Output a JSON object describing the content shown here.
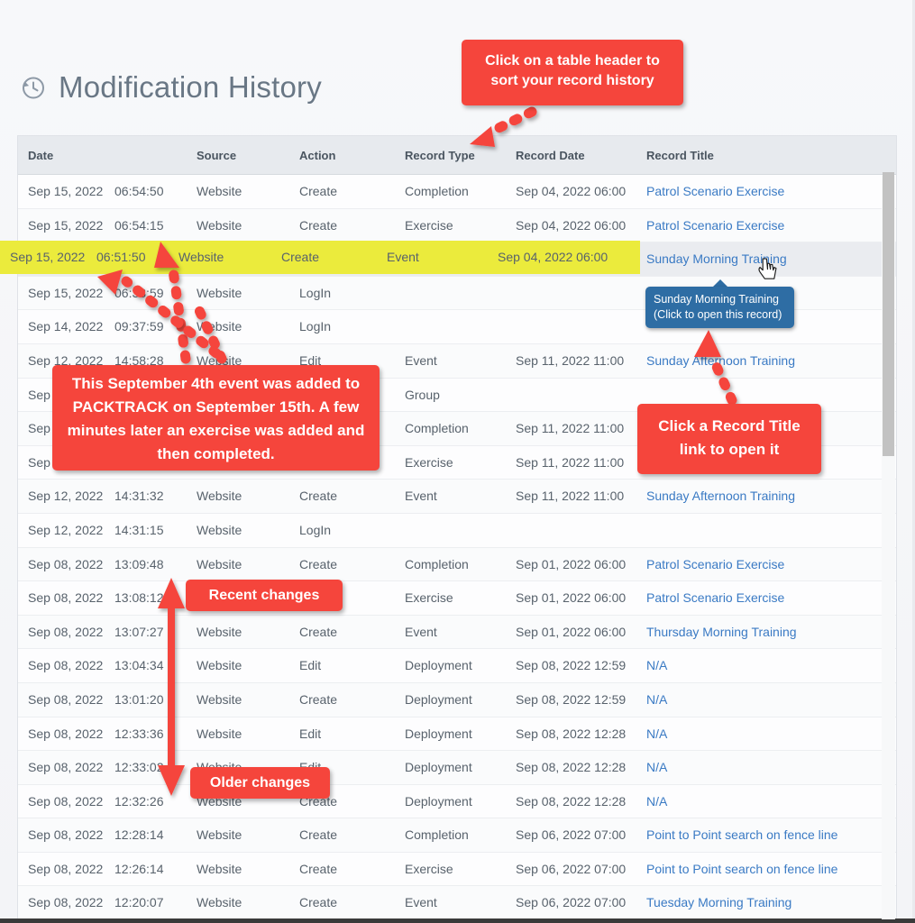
{
  "page": {
    "title": "Modification History",
    "title_icon": "history-clock-icon"
  },
  "table": {
    "columns": [
      "Date",
      "Source",
      "Action",
      "Record Type",
      "Record Date",
      "Record Title"
    ],
    "rows": [
      {
        "date": "Sep 15, 2022",
        "time": "06:54:50",
        "source": "Website",
        "action": "Create",
        "record_type": "Completion",
        "record_date": "Sep 04, 2022 06:00",
        "record_title": "Patrol Scenario Exercise",
        "state": "normal"
      },
      {
        "date": "Sep 15, 2022",
        "time": "06:54:15",
        "source": "Website",
        "action": "Create",
        "record_type": "Exercise",
        "record_date": "Sep 04, 2022 06:00",
        "record_title": "Patrol Scenario Exercise",
        "state": "normal"
      },
      {
        "date": "Sep 15, 2022",
        "time": "06:51:50",
        "source": "Website",
        "action": "Create",
        "record_type": "Event",
        "record_date": "Sep 04, 2022 06:00",
        "record_title": "Sunday Morning Training",
        "state": "highlight"
      },
      {
        "date": "Sep 15, 2022",
        "time": "06:38:59",
        "source": "Website",
        "action": "LogIn",
        "record_type": "",
        "record_date": "",
        "record_title": "",
        "state": "normal"
      },
      {
        "date": "Sep 14, 2022",
        "time": "09:37:59",
        "source": "Website",
        "action": "LogIn",
        "record_type": "",
        "record_date": "",
        "record_title": "",
        "state": "normal"
      },
      {
        "date": "Sep 12, 2022",
        "time": "14:58:28",
        "source": "Website",
        "action": "Edit",
        "record_type": "Event",
        "record_date": "Sep 11, 2022 11:00",
        "record_title": "Sunday Afternoon Training",
        "state": "normal"
      },
      {
        "date": "Sep",
        "time": "",
        "source": "",
        "action": "",
        "record_type": "Group",
        "record_date": "",
        "record_title": "",
        "state": "normal"
      },
      {
        "date": "Sep",
        "time": "",
        "source": "",
        "action": "",
        "record_type": "Completion",
        "record_date": "Sep 11, 2022 11:00",
        "record_title": "",
        "state": "normal"
      },
      {
        "date": "Sep",
        "time": "",
        "source": "",
        "action": "",
        "record_type": "Exercise",
        "record_date": "Sep 11, 2022 11:00",
        "record_title": "",
        "state": "normal"
      },
      {
        "date": "Sep 12, 2022",
        "time": "14:31:32",
        "source": "Website",
        "action": "Create",
        "record_type": "Event",
        "record_date": "Sep 11, 2022 11:00",
        "record_title": "Sunday Afternoon Training",
        "state": "normal"
      },
      {
        "date": "Sep 12, 2022",
        "time": "14:31:15",
        "source": "Website",
        "action": "LogIn",
        "record_type": "",
        "record_date": "",
        "record_title": "",
        "state": "normal"
      },
      {
        "date": "Sep 08, 2022",
        "time": "13:09:48",
        "source": "Website",
        "action": "Create",
        "record_type": "Completion",
        "record_date": "Sep 01, 2022 06:00",
        "record_title": "Patrol Scenario Exercise",
        "state": "normal"
      },
      {
        "date": "Sep 08, 2022",
        "time": "13:08:12",
        "source": "Website",
        "action": "",
        "record_type": "Exercise",
        "record_date": "Sep 01, 2022 06:00",
        "record_title": "Patrol Scenario Exercise",
        "state": "normal"
      },
      {
        "date": "Sep 08, 2022",
        "time": "13:07:27",
        "source": "Website",
        "action": "Create",
        "record_type": "Event",
        "record_date": "Sep 01, 2022 06:00",
        "record_title": "Thursday Morning Training",
        "state": "normal"
      },
      {
        "date": "Sep 08, 2022",
        "time": "13:04:34",
        "source": "Website",
        "action": "Edit",
        "record_type": "Deployment",
        "record_date": "Sep 08, 2022 12:59",
        "record_title": "N/A",
        "state": "normal"
      },
      {
        "date": "Sep 08, 2022",
        "time": "13:01:20",
        "source": "Website",
        "action": "Create",
        "record_type": "Deployment",
        "record_date": "Sep 08, 2022 12:59",
        "record_title": "N/A",
        "state": "normal"
      },
      {
        "date": "Sep 08, 2022",
        "time": "12:33:36",
        "source": "Website",
        "action": "Edit",
        "record_type": "Deployment",
        "record_date": "Sep 08, 2022 12:28",
        "record_title": "N/A",
        "state": "normal"
      },
      {
        "date": "Sep 08, 2022",
        "time": "12:33:02",
        "source": "Website",
        "action": "Edit",
        "record_type": "Deployment",
        "record_date": "Sep 08, 2022 12:28",
        "record_title": "N/A",
        "state": "normal"
      },
      {
        "date": "Sep 08, 2022",
        "time": "12:32:26",
        "source": "Website",
        "action": "Create",
        "record_type": "Deployment",
        "record_date": "Sep 08, 2022 12:28",
        "record_title": "N/A",
        "state": "normal"
      },
      {
        "date": "Sep 08, 2022",
        "time": "12:28:14",
        "source": "Website",
        "action": "Create",
        "record_type": "Completion",
        "record_date": "Sep 06, 2022 07:00",
        "record_title": "Point to Point search on fence line",
        "state": "normal"
      },
      {
        "date": "Sep 08, 2022",
        "time": "12:26:14",
        "source": "Website",
        "action": "Create",
        "record_type": "Exercise",
        "record_date": "Sep 06, 2022 07:00",
        "record_title": "Point to Point search on fence line",
        "state": "normal"
      },
      {
        "date": "Sep 08, 2022",
        "time": "12:20:07",
        "source": "Website",
        "action": "Create",
        "record_type": "Event",
        "record_date": "Sep 06, 2022 07:00",
        "record_title": "Tuesday Morning Training",
        "state": "normal"
      }
    ]
  },
  "annotations": {
    "sort_callout": "Click on a table header to sort your record history",
    "explain_callout": "This September 4th event was added to PACKTRACK on September 15th. A few minutes later an exercise was added and then completed.",
    "open_callout": "Click a Record Title link to open it",
    "recent_badge": "Recent changes",
    "older_badge": "Older changes"
  },
  "tooltip": {
    "line1": "Sunday Morning Training",
    "line2": "(Click to open this record)"
  },
  "colors": {
    "annotation_red": "#f5453c",
    "tooltip_blue": "#2e6da4",
    "highlight_yellow": "#ebeb3c",
    "link_blue": "#3a7ac4",
    "header_bg": "#e7eaee"
  }
}
